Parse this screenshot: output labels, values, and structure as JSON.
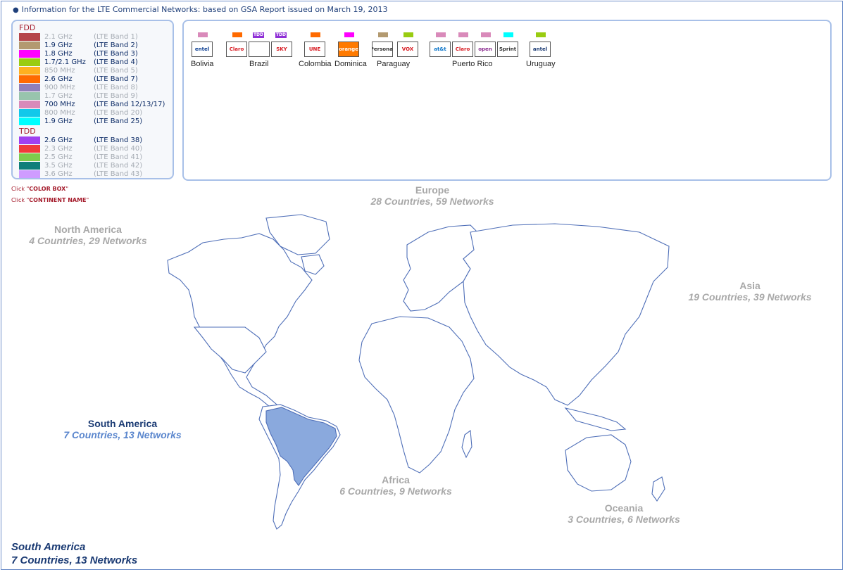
{
  "info_line": "Information for the LTE Commercial Networks: based on GSA Report issued on March 19, 2013",
  "legend": {
    "fdd_title": "FDD",
    "tdd_title": "TDD",
    "fdd": [
      {
        "freq": "2.1 GHz",
        "band": "(LTE Band 1)",
        "color": "#b5454a",
        "active": false
      },
      {
        "freq": "1.9 GHz",
        "band": "(LTE Band 2)",
        "color": "#b39a70",
        "active": true
      },
      {
        "freq": "1.8 GHz",
        "band": "(LTE Band 3)",
        "color": "#ff00ff",
        "active": true
      },
      {
        "freq": "1.7/2.1 GHz",
        "band": "(LTE Band 4)",
        "color": "#99cc11",
        "active": true
      },
      {
        "freq": "850 MHz",
        "band": "(LTE Band 5)",
        "color": "#ffb020",
        "active": false
      },
      {
        "freq": "2.6 GHz",
        "band": "(LTE Band 7)",
        "color": "#ff6a00",
        "active": true
      },
      {
        "freq": "900 MHz",
        "band": "(LTE Band 8)",
        "color": "#8f7fb8",
        "active": false
      },
      {
        "freq": "1.7 GHz",
        "band": "(LTE Band 9)",
        "color": "#98c4ad",
        "active": false
      },
      {
        "freq": "700 MHz",
        "band": "(LTE Band 12/13/17)",
        "color": "#d98aba",
        "active": true
      },
      {
        "freq": "800 MHz",
        "band": "(LTE Band 20)",
        "color": "#12c8ea",
        "active": false
      },
      {
        "freq": "1.9 GHz",
        "band": "(LTE Band 25)",
        "color": "#00ffff",
        "active": true
      }
    ],
    "tdd": [
      {
        "freq": "2.6 GHz",
        "band": "(LTE Band 38)",
        "color": "#a040f0",
        "active": true
      },
      {
        "freq": "2.3 GHz",
        "band": "(LTE Band 40)",
        "color": "#f03a3a",
        "active": false
      },
      {
        "freq": "2.5 GHz",
        "band": "(LTE Band 41)",
        "color": "#7ccc4c",
        "active": false
      },
      {
        "freq": "3.5 GHz",
        "band": "(LTE Band 42)",
        "color": "#0f7f7a",
        "active": false
      },
      {
        "freq": "3.6 GHz",
        "band": "(LTE Band 43)",
        "color": "#cf9cff",
        "active": false
      }
    ]
  },
  "instructions": {
    "line1_prefix": "Click \"",
    "line1_bold": "COLOR BOX",
    "line1_suffix": "\"",
    "line2_prefix": "Click \"",
    "line2_bold": "CONTINENT NAME",
    "line2_suffix": "\""
  },
  "operators": [
    {
      "name": "entel",
      "color": "#d98aba",
      "tdd": false,
      "logo_color": "#0a3d91"
    },
    {
      "name": "Claro",
      "color": "#ff6a00",
      "tdd": false,
      "logo_color": "#d71920"
    },
    {
      "name": "",
      "color": "#a040f0",
      "tdd": true,
      "tdd_label": "TDD",
      "logo_color": "#2a9bbd"
    },
    {
      "name": "SKY",
      "color": "#a040f0",
      "tdd": true,
      "tdd_label": "TDD",
      "logo_color": "#d71920"
    },
    {
      "name": "UNE",
      "color": "#ff6a00",
      "tdd": false,
      "logo_color": "#d71920"
    },
    {
      "name": "orange",
      "color": "#ff00ff",
      "tdd": false,
      "logo_color": "#ffffff"
    },
    {
      "name": "Personal",
      "color": "#b39a70",
      "tdd": false,
      "logo_color": "#333333"
    },
    {
      "name": "VOX",
      "color": "#99cc11",
      "tdd": false,
      "logo_color": "#d71920"
    },
    {
      "name": "at&t",
      "color": "#d98aba",
      "tdd": false,
      "logo_color": "#0a74c9"
    },
    {
      "name": "Claro",
      "color": "#d98aba",
      "tdd": false,
      "logo_color": "#d71920"
    },
    {
      "name": "open",
      "color": "#d98aba",
      "tdd": false,
      "logo_color": "#8a2a8f"
    },
    {
      "name": "Sprint",
      "color": "#00ffff",
      "tdd": false,
      "logo_color": "#333333"
    },
    {
      "name": "antel",
      "color": "#99cc11",
      "tdd": false,
      "logo_color": "#1a3a73"
    }
  ],
  "countries": [
    "Bolivia",
    "Brazil",
    "Colombia",
    "Dominica",
    "Paraguay",
    "Puerto Rico",
    "Uruguay"
  ],
  "continents": {
    "europe": {
      "name": "Europe",
      "stats": "28 Countries, 59 Networks"
    },
    "north_america": {
      "name": "North America",
      "stats": "4 Countries, 29 Networks"
    },
    "asia": {
      "name": "Asia",
      "stats": "19 Countries, 39 Networks"
    },
    "south_america": {
      "name": "South America",
      "stats": "7 Countries, 13 Networks",
      "selected": true
    },
    "africa": {
      "name": "Africa",
      "stats": "6 Countries, 9 Networks"
    },
    "oceania": {
      "name": "Oceania",
      "stats": "3 Countries, 6 Networks"
    }
  },
  "selected_summary": {
    "name": "South America",
    "stats": "7 Countries, 13 Networks"
  },
  "map": {
    "highlight_color": "#8aa9dd",
    "line_color": "#4f6fb8"
  }
}
